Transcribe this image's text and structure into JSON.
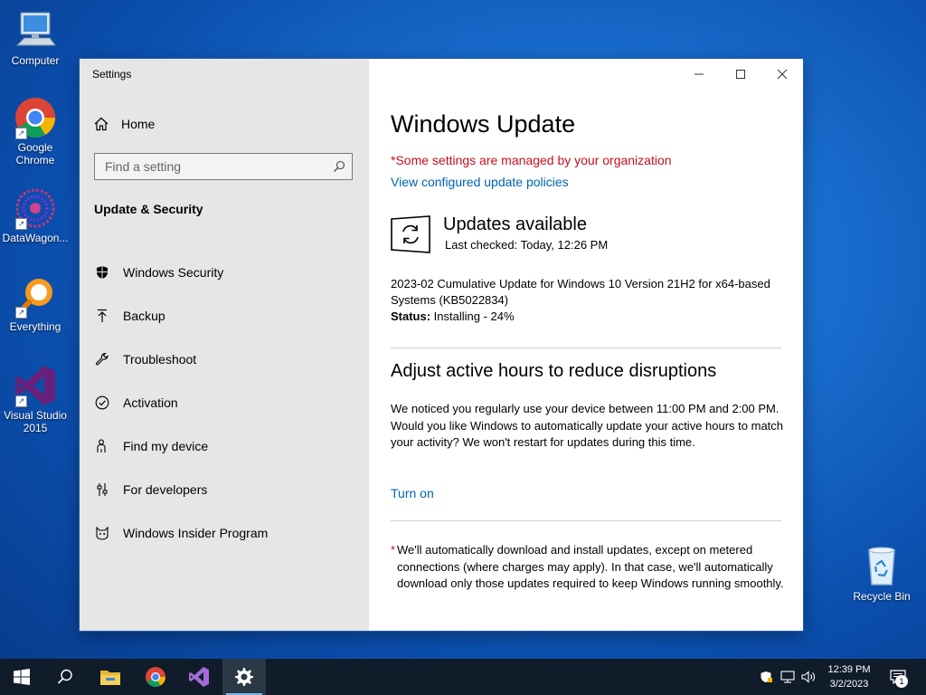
{
  "desktop": {
    "icons": [
      {
        "label": "Computer"
      },
      {
        "label": "Google Chrome"
      },
      {
        "label": "DataWagon..."
      },
      {
        "label": "Everything"
      },
      {
        "label": "Visual Studio 2015"
      },
      {
        "label": "Recycle Bin"
      }
    ]
  },
  "window": {
    "app_title": "Settings",
    "controls": {
      "minimize_icon": "minimize-icon",
      "maximize_icon": "maximize-icon",
      "close_icon": "close-icon"
    }
  },
  "sidebar": {
    "home_label": "Home",
    "search_placeholder": "Find a setting",
    "section_title": "Update & Security",
    "items": [
      {
        "label": "Windows Security",
        "icon": "shield-icon"
      },
      {
        "label": "Backup",
        "icon": "backup-arrow-icon"
      },
      {
        "label": "Troubleshoot",
        "icon": "wrench-icon"
      },
      {
        "label": "Activation",
        "icon": "check-circle-icon"
      },
      {
        "label": "Find my device",
        "icon": "person-locate-icon"
      },
      {
        "label": "For developers",
        "icon": "developer-sliders-icon"
      },
      {
        "label": "Windows Insider Program",
        "icon": "insider-cat-icon"
      }
    ]
  },
  "main": {
    "title": "Windows Update",
    "managed_notice": "*Some settings are managed by your organization",
    "policies_link": "View configured update policies",
    "update": {
      "heading": "Updates available",
      "last_checked": "Last checked: Today, 12:26 PM",
      "description": "2023-02 Cumulative Update for Windows 10 Version 21H2 for x64-based Systems (KB5022834)",
      "status_label": "Status:",
      "status_value": " Installing - 24%"
    },
    "active_hours": {
      "heading": "Adjust active hours to reduce disruptions",
      "paragraph": "We noticed you regularly use your device between 11:00 PM and 2:00 PM. Would you like Windows to automatically update your active hours to match your activity? We won't restart for updates during this time.",
      "turn_on_link": "Turn on"
    },
    "footnote_star": "*",
    "footnote": "We'll automatically download and install updates, except on metered connections (where charges may apply). In that case, we'll automatically download only those updates required to keep Windows running smoothly."
  },
  "taskbar": {
    "apps": [
      "start-icon",
      "search-icon",
      "file-explorer-icon",
      "chrome-icon",
      "visual-studio-icon",
      "settings-gear-icon"
    ],
    "time": "12:39 PM",
    "date": "3/2/2023",
    "notification_count": "1"
  },
  "colors": {
    "accent_link": "#0063b1",
    "warning_red": "#c50f1f",
    "taskbar": "#101c2a"
  }
}
